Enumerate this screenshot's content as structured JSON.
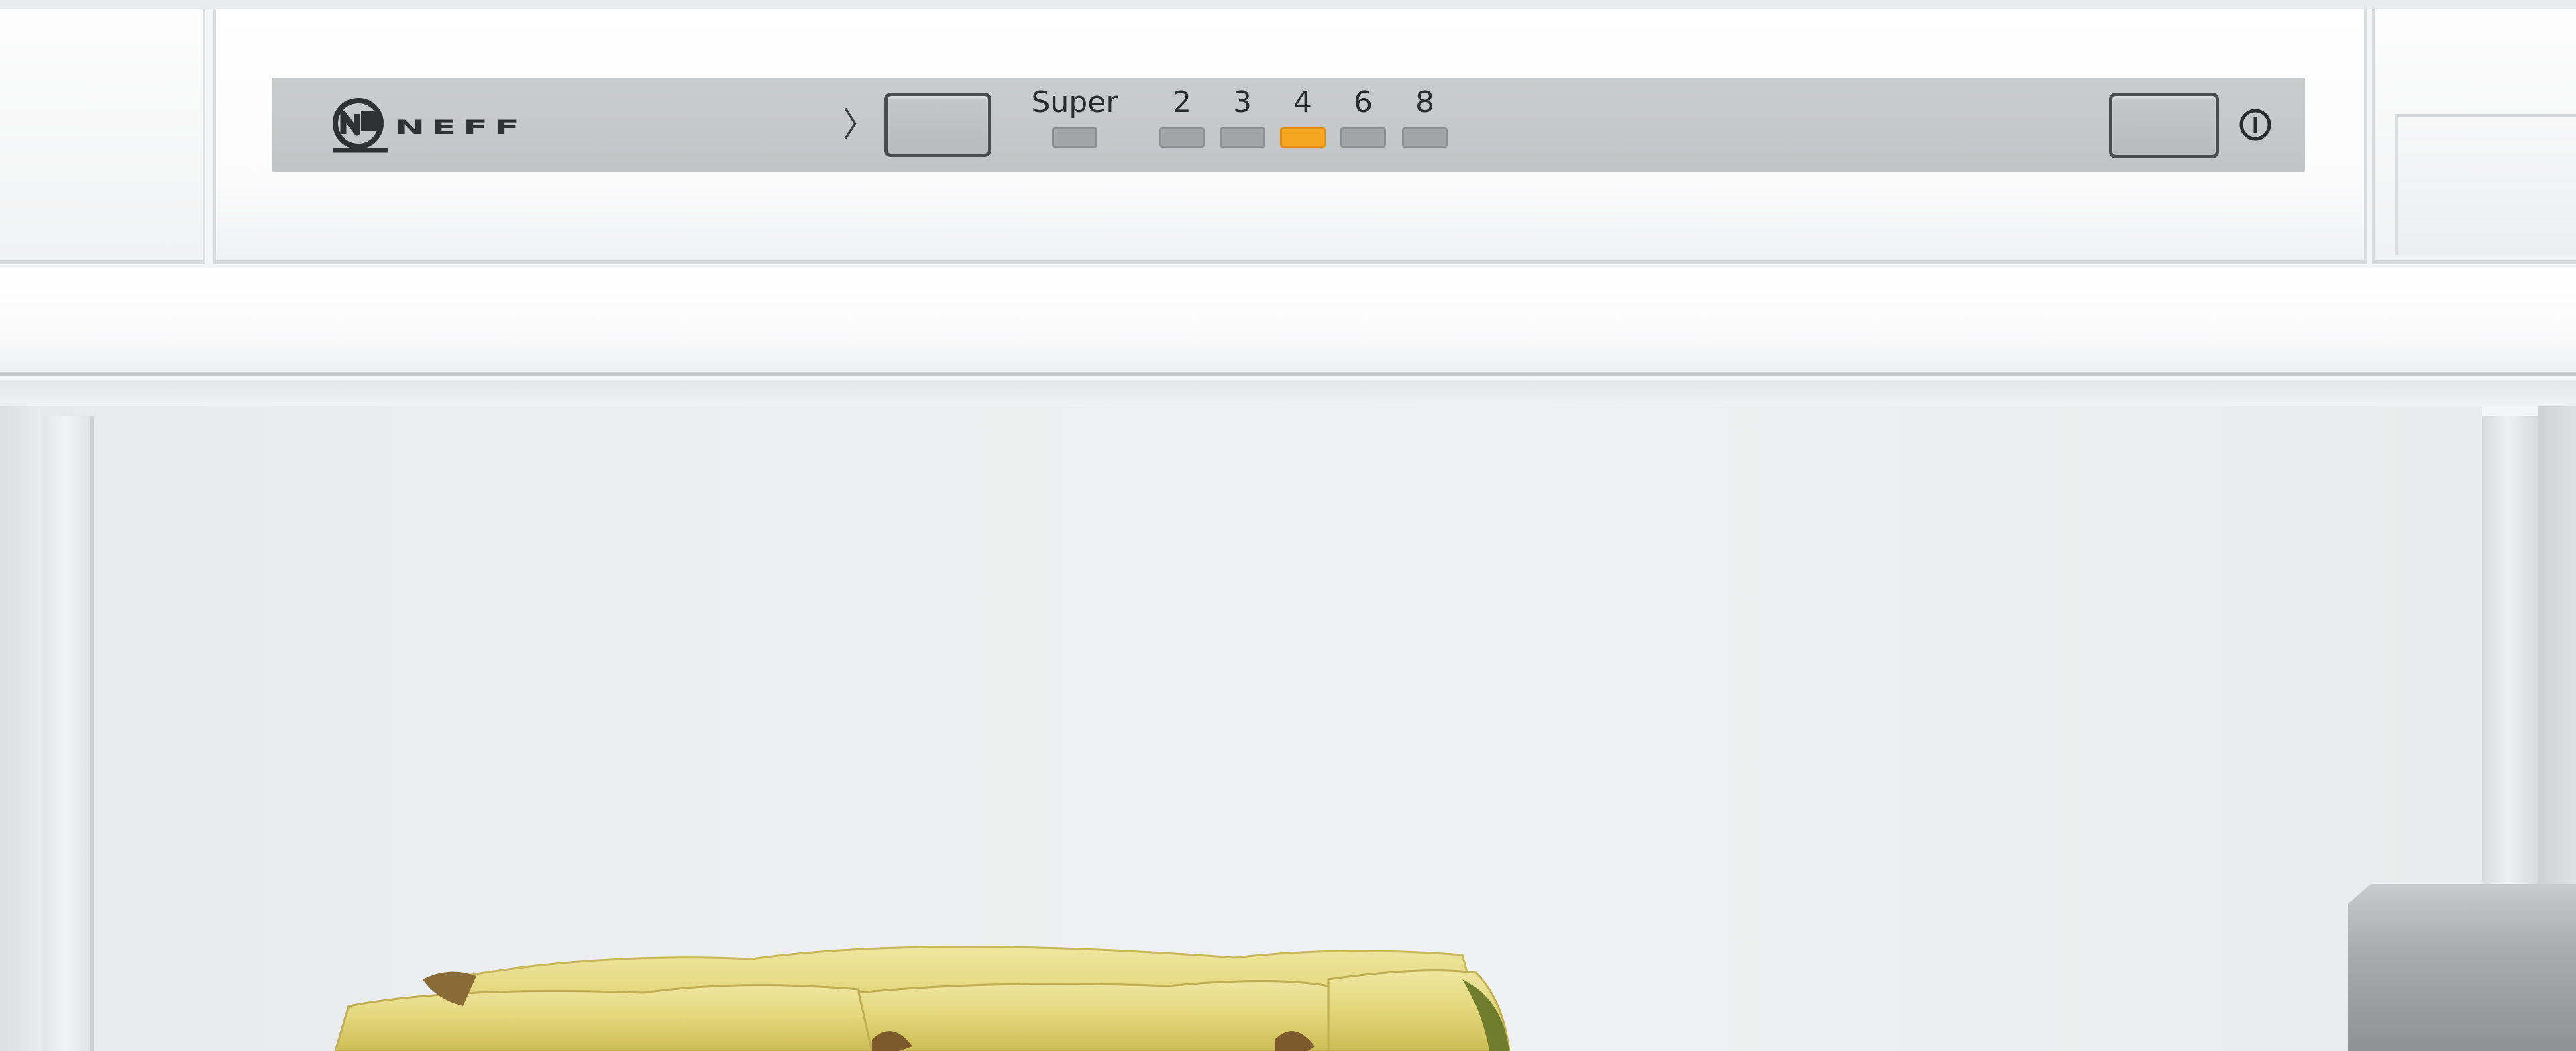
{
  "brand": {
    "name": "NEFF"
  },
  "control_panel": {
    "arrow": "〉",
    "super_label": "Super",
    "level_labels": [
      "2",
      "3",
      "4",
      "6",
      "8"
    ],
    "active_level": "4"
  },
  "colors": {
    "panel_strip": "#c6c7c8",
    "led_off": "#a3a4a6",
    "led_on": "#f4a623",
    "button_border": "#4a4b4d"
  },
  "icons": {
    "logo": "neff-logo-icon",
    "power": "power-icon",
    "arrow": "chevron-right-icon"
  }
}
